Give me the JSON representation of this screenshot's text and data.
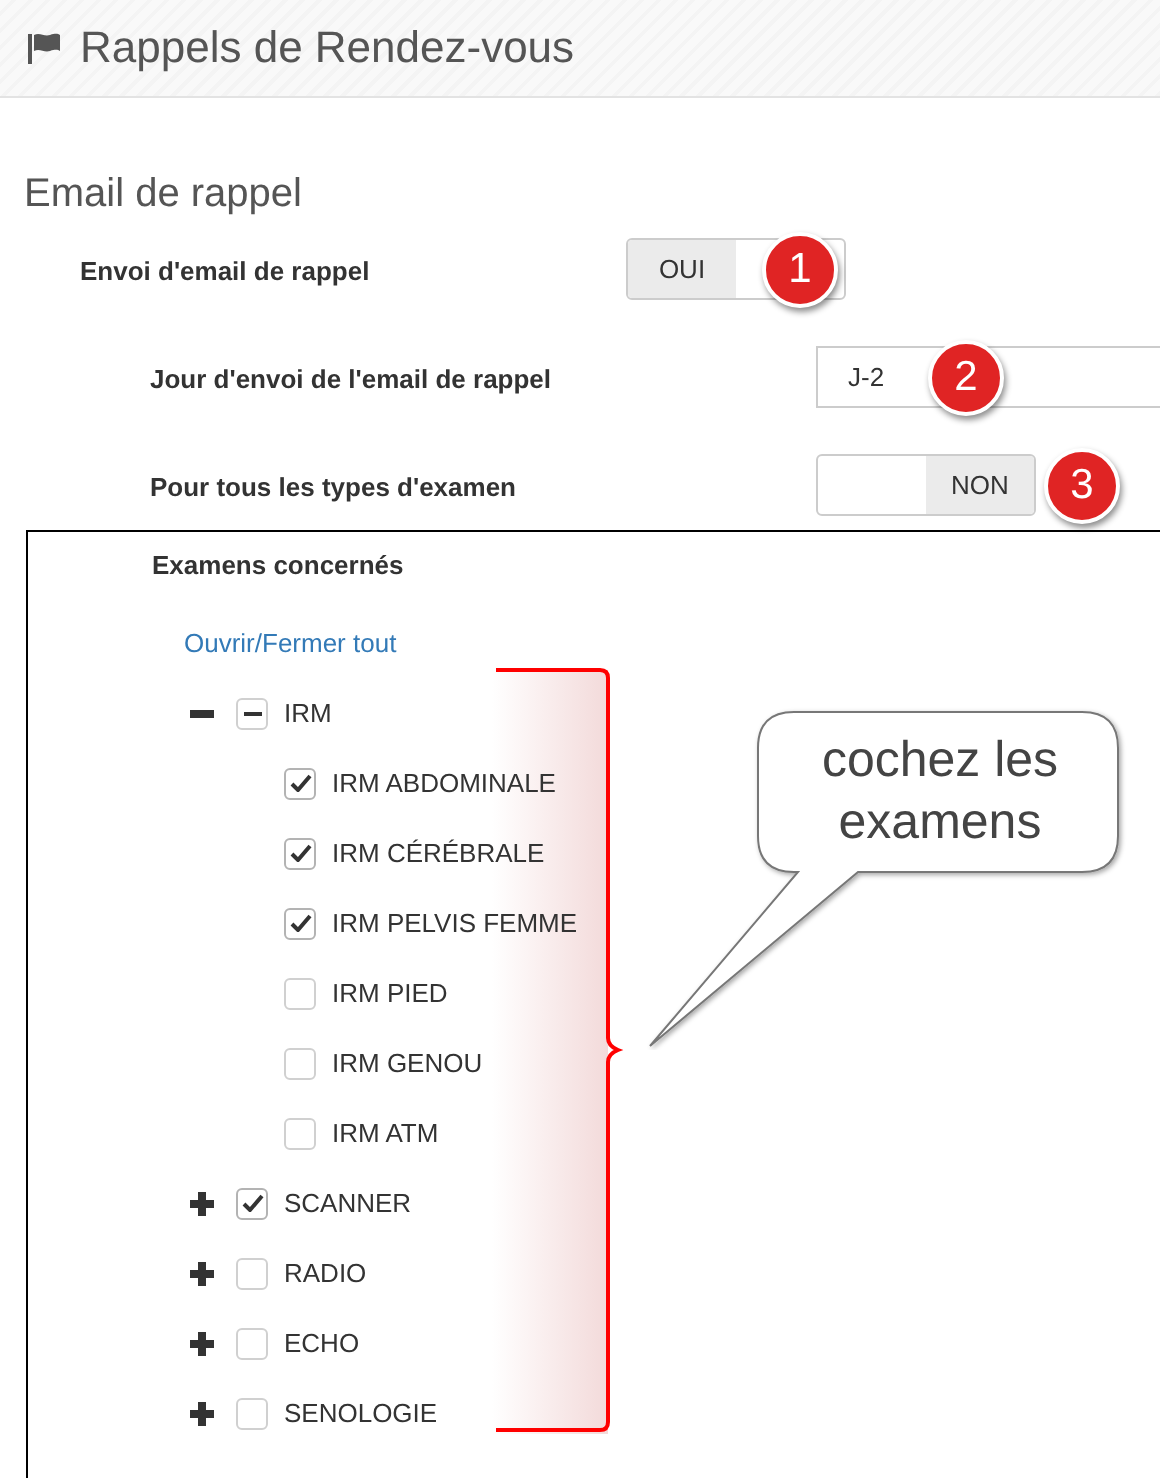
{
  "header": {
    "title": "Rappels de Rendez-vous"
  },
  "section": {
    "title": "Email de rappel"
  },
  "fields": [
    {
      "kind": "toggle",
      "label": "Envoi d'email de rappel",
      "value": "OUI",
      "on": true,
      "badge": "1",
      "children": [
        {
          "kind": "select",
          "label": "Jour d'envoi de l'email de rappel",
          "value": "J-2",
          "badge": "2"
        },
        {
          "kind": "toggle",
          "label": "Pour tous les types d'examen",
          "value": "NON",
          "on": false,
          "badge": "3"
        }
      ]
    }
  ],
  "exams": {
    "title": "Examens concernés",
    "toggle_all": "Ouvrir/Fermer tout",
    "items": [
      {
        "label": "IRM",
        "indeterminate": true,
        "expanded": true,
        "children": [
          {
            "label": "IRM ABDOMINALE",
            "checked": true
          },
          {
            "label": "IRM CÉRÉBRALE",
            "checked": true
          },
          {
            "label": "IRM PELVIS FEMME",
            "checked": true
          },
          {
            "label": "IRM PIED",
            "checked": false
          },
          {
            "label": "IRM GENOU",
            "checked": false
          },
          {
            "label": "IRM ATM",
            "checked": false
          }
        ]
      },
      {
        "label": "SCANNER",
        "checked": true,
        "indeterminate": false,
        "expanded": false
      },
      {
        "label": "RADIO",
        "checked": false,
        "indeterminate": false,
        "expanded": false
      },
      {
        "label": "ECHO",
        "checked": false,
        "indeterminate": false,
        "expanded": false
      },
      {
        "label": "SENOLOGIE",
        "checked": false,
        "indeterminate": false,
        "expanded": false
      }
    ]
  },
  "callout": {
    "text": "cochez les examens"
  }
}
